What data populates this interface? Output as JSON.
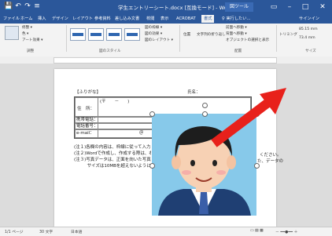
{
  "titlebar": {
    "document_title": "学生エントリーシート.docx [互換モード] - Word",
    "context_tab": "図ツール"
  },
  "menu": {
    "items": [
      "ファイル",
      "ホーム",
      "挿入",
      "デザイン",
      "レイアウト",
      "参考資料",
      "差し込み文書",
      "校閲",
      "表示",
      "ACROBAT",
      "書式"
    ],
    "active": "書式",
    "tell_me": "♀ 実行したい…",
    "user": "サインイン"
  },
  "ribbon": {
    "adjust_group": "調整",
    "styles_group": "図のスタイル",
    "arrange_group": "配置",
    "size_group": "サイズ",
    "lines": [
      "修整 ▾",
      "色 ▾",
      "アート効果 ▾",
      "図の枠線 ▾",
      "図の効果 ▾",
      "図のレイアウト ▾",
      "位置",
      "文字列の折り返し",
      "前面へ移動 ▾",
      "背面へ移動 ▾",
      "オブジェクトの選択と表示",
      "トリミング",
      "85.15 mm",
      "73.4 mm"
    ]
  },
  "document": {
    "furigana_label": "【ふりがな】",
    "name_label": "氏名：",
    "address_label": "住　所：",
    "postal_mark": "(〒　　－　　)",
    "mobile_label": "携帯電話：",
    "phone_label": "電話番号：",
    "email_label": "e-mail：",
    "email_at": "＠",
    "note1": "(注１)各欄の内容は、枠線に従って入力してください。",
    "note2": "(注２)Wordで作成し、作成する際は、右上の方に写真を貼り付けてください。",
    "note3": "(注３)写真データは、正面を向いた写真を使用してください。",
    "note4": "　　　サイズは10MBを超えないようにしてください。",
    "note_right1": "ください。",
    "note_right2": "た、データの"
  },
  "statusbar": {
    "page": "1/1 ページ",
    "words": "30 文字",
    "lang": "日本語"
  },
  "colors": {
    "word_blue": "#2b579a",
    "arrow_red": "#e8211b",
    "photo_sky": "#87c9ea",
    "suit_navy": "#1f3f73"
  },
  "icons": {
    "save": "save-icon",
    "undo": "undo-icon",
    "redo": "redo-icon",
    "arrow": "red-arrow-annotation",
    "rotate": "rotate-handle-icon"
  }
}
